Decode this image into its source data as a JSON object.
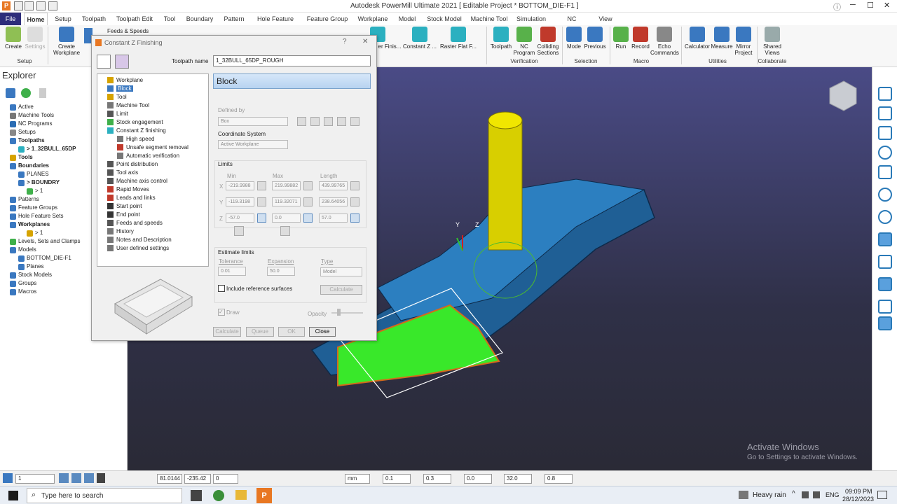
{
  "window": {
    "title": "Autodesk PowerMill Ultimate 2021    [ Editable Project * BOTTOM_DIE-F1 ]"
  },
  "ribbon_tabs": [
    "File",
    "Home",
    "Setup",
    "Toolpath",
    "Toolpath Edit",
    "Tool",
    "Boundary",
    "Pattern",
    "Hole Feature Set",
    "Feature Group",
    "Workplane",
    "Model",
    "Stock Model",
    "Machine Tool",
    "Simulation",
    "NC Program",
    "View"
  ],
  "ribbon": {
    "create": "Create",
    "settings": "Settings",
    "create_workplane": "Create\nWorkplane",
    "feeds_speeds": "Feeds & Speeds",
    "er_finis": "er Finis...",
    "constant_z": "Constant Z ...",
    "raster_flat": "Raster Flat F...",
    "toolpath": "Toolpath",
    "nc_program": "NC\nProgram",
    "colliding_sections": "Colliding\nSections",
    "mode": "Mode",
    "previous": "Previous",
    "run": "Run",
    "record": "Record",
    "echo_commands": "Echo\nCommands",
    "calculator": "Calculator",
    "measure": "Measure",
    "mirror_project": "Mirror\nProject",
    "shared_views": "Shared\nViews",
    "groups": [
      "Setup",
      "Verification",
      "Selection",
      "Macro",
      "Utilities",
      "Collaborate"
    ]
  },
  "explorer": {
    "title": "Explorer",
    "items": [
      {
        "label": "Active",
        "bold": false,
        "indent": 0,
        "color": "#3a78c0"
      },
      {
        "label": "Machine Tools",
        "bold": false,
        "indent": 0,
        "color": "#777"
      },
      {
        "label": "NC Programs",
        "bold": false,
        "indent": 0,
        "color": "#2a6cb3"
      },
      {
        "label": "Setups",
        "bold": false,
        "indent": 0,
        "color": "#888"
      },
      {
        "label": "Toolpaths",
        "bold": true,
        "indent": 0,
        "color": "#3a78c0"
      },
      {
        "label": "> 1_32BULL_65DP",
        "bold": true,
        "indent": 1,
        "color": "#2bb0c0"
      },
      {
        "label": "Tools",
        "bold": true,
        "indent": 0,
        "color": "#d6a300"
      },
      {
        "label": "Boundaries",
        "bold": true,
        "indent": 0,
        "color": "#3a78c0"
      },
      {
        "label": "PLANES",
        "bold": false,
        "indent": 1,
        "color": "#3a78c0"
      },
      {
        "label": "> BOUNDRY",
        "bold": true,
        "indent": 1,
        "color": "#3a78c0"
      },
      {
        "label": "> 1",
        "bold": false,
        "indent": 2,
        "color": "#3fb04a"
      },
      {
        "label": "Patterns",
        "bold": false,
        "indent": 0,
        "color": "#3a78c0"
      },
      {
        "label": "Feature Groups",
        "bold": false,
        "indent": 0,
        "color": "#3a78c0"
      },
      {
        "label": "Hole Feature Sets",
        "bold": false,
        "indent": 0,
        "color": "#3a78c0"
      },
      {
        "label": "Workplanes",
        "bold": true,
        "indent": 0,
        "color": "#3a78c0"
      },
      {
        "label": "> 1",
        "bold": false,
        "indent": 2,
        "color": "#d6a300"
      },
      {
        "label": "Levels, Sets and Clamps",
        "bold": false,
        "indent": 0,
        "color": "#3fb04a"
      },
      {
        "label": "Models",
        "bold": false,
        "indent": 0,
        "color": "#3a78c0"
      },
      {
        "label": "BOTTOM_DIE-F1",
        "bold": false,
        "indent": 1,
        "color": "#3a78c0"
      },
      {
        "label": "Planes",
        "bold": false,
        "indent": 1,
        "color": "#3a78c0"
      },
      {
        "label": "Stock Models",
        "bold": false,
        "indent": 0,
        "color": "#3a78c0"
      },
      {
        "label": "Groups",
        "bold": false,
        "indent": 0,
        "color": "#3a78c0"
      },
      {
        "label": "Macros",
        "bold": false,
        "indent": 0,
        "color": "#3a78c0"
      }
    ]
  },
  "dialog": {
    "title": "Constant Z Finishing",
    "help": "?",
    "close_x": "✕",
    "toolpath_name_label": "Toolpath name",
    "toolpath_name": "1_32BULL_65DP_ROUGH",
    "tree": [
      {
        "label": "Workplane",
        "indent": 0,
        "color": "#d6a300"
      },
      {
        "label": "Block",
        "indent": 0,
        "color": "#3a78c0",
        "selected": true
      },
      {
        "label": "Tool",
        "indent": 0,
        "color": "#d6a300"
      },
      {
        "label": "Machine Tool",
        "indent": 0,
        "color": "#777"
      },
      {
        "label": "Limit",
        "indent": 0,
        "color": "#555"
      },
      {
        "label": "Stock engagement",
        "indent": 0,
        "color": "#3fb04a"
      },
      {
        "label": "Constant Z finishing",
        "indent": 0,
        "color": "#2bb0c0"
      },
      {
        "label": "High speed",
        "indent": 1,
        "color": "#777"
      },
      {
        "label": "Unsafe segment removal",
        "indent": 1,
        "color": "#c0392b"
      },
      {
        "label": "Automatic verification",
        "indent": 1,
        "color": "#777"
      },
      {
        "label": "Point distribution",
        "indent": 0,
        "color": "#555"
      },
      {
        "label": "Tool axis",
        "indent": 0,
        "color": "#555"
      },
      {
        "label": "Machine axis control",
        "indent": 0,
        "color": "#555"
      },
      {
        "label": "Rapid Moves",
        "indent": 0,
        "color": "#c0392b"
      },
      {
        "label": "Leads and links",
        "indent": 0,
        "color": "#c0392b"
      },
      {
        "label": "Start point",
        "indent": 0,
        "color": "#333"
      },
      {
        "label": "End point",
        "indent": 0,
        "color": "#333"
      },
      {
        "label": "Feeds and speeds",
        "indent": 0,
        "color": "#555"
      },
      {
        "label": "History",
        "indent": 0,
        "color": "#777"
      },
      {
        "label": "Notes and Description",
        "indent": 0,
        "color": "#777"
      },
      {
        "label": "User defined settings",
        "indent": 0,
        "color": "#777"
      }
    ],
    "panel_title": "Block",
    "defined_by_label": "Defined by",
    "defined_by": "Box",
    "coord_system_label": "Coordinate System",
    "coord_system": "Active Workplane",
    "limits_label": "Limits",
    "min_label": "Min",
    "max_label": "Max",
    "length_label": "Length",
    "x": {
      "label": "X",
      "min": "-219.9988",
      "max": "219.99882",
      "length": "439.99765"
    },
    "y": {
      "label": "Y",
      "min": "-119.3198",
      "max": "119.32071",
      "length": "238.64056"
    },
    "z": {
      "label": "Z",
      "min": "-57.0",
      "max": "0.0",
      "length": "57.0"
    },
    "estimate_label": "Estimate limits",
    "tolerance_label": "Tolerance",
    "tolerance": "0.01",
    "expansion_label": "Expansion",
    "expansion": "50.0",
    "type_label": "Type",
    "type": "Model",
    "include_ref": "Include reference surfaces",
    "calculate_inner": "Calculate",
    "draw_label": "Draw",
    "opacity_label": "Opacity",
    "buttons": {
      "calculate": "Calculate",
      "queue": "Queue",
      "ok": "OK",
      "close": "Close"
    }
  },
  "viewport": {
    "axis_y": "Y",
    "axis_z": "Z",
    "watermark_title": "Activate Windows",
    "watermark_sub": "Go to Settings to activate Windows."
  },
  "status": {
    "workplane": "1",
    "x": "81.0144",
    "y": "-235.42",
    "z": "0",
    "units": "mm",
    "tol": "0.1",
    "thickness": "0.3",
    "v1": "0.0",
    "diameter": "32.0",
    "v2": "0.8"
  },
  "taskbar": {
    "search_placeholder": "Type here to search",
    "weather": "Heavy rain",
    "lang": "ENG",
    "time": "09:09 PM",
    "date": "28/12/2023"
  },
  "colors": {
    "accent": "#2d2d7a",
    "part": "#1f6aa8",
    "stock": "#39e82a",
    "tool": "#f0e600"
  }
}
